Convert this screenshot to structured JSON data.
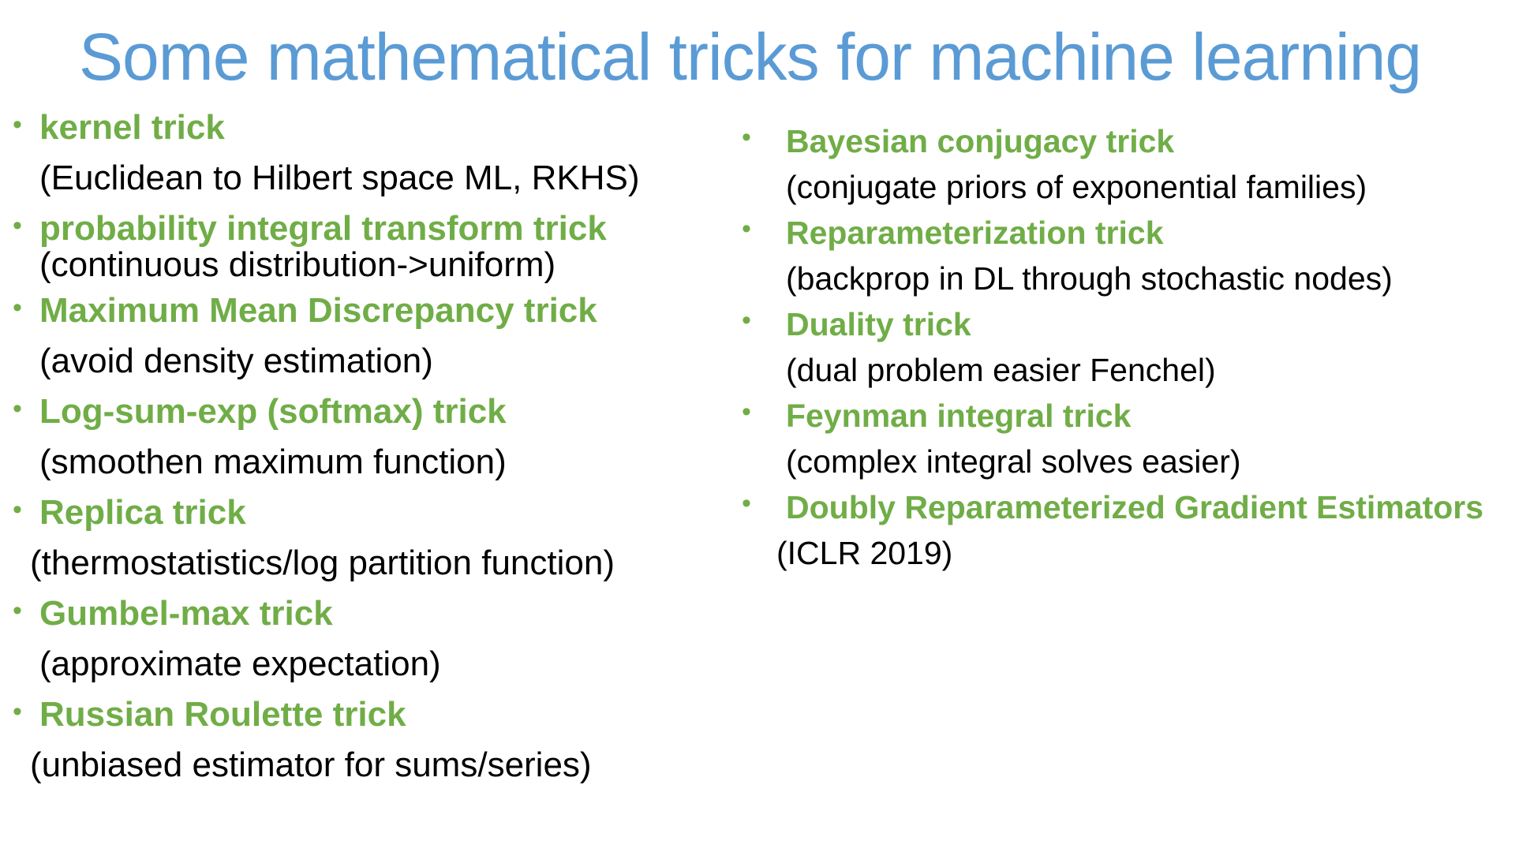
{
  "slide": {
    "title": "Some mathematical tricks for machine learning",
    "colors": {
      "title": "#5b9bd5",
      "heading": "#70ad47",
      "text": "#000000"
    },
    "bullet_glyph": "•",
    "left_items": [
      {
        "heading": "kernel trick",
        "description": "(Euclidean to Hilbert space ML, RKHS)"
      },
      {
        "heading": "probability integral transform trick",
        "description": "(continuous distribution->uniform)"
      },
      {
        "heading": "Maximum Mean Discrepancy trick",
        "description": "(avoid density estimation)"
      },
      {
        "heading": "Log-sum-exp (softmax) trick",
        "description": "(smoothen maximum function)"
      },
      {
        "heading": "Replica trick",
        "description": "(thermostatistics/log partition function)"
      },
      {
        "heading": "Gumbel-max trick",
        "description": "(approximate expectation)"
      },
      {
        "heading": "Russian Roulette trick",
        "description": "(unbiased estimator for sums/series)"
      }
    ],
    "right_items": [
      {
        "heading": "Bayesian conjugacy trick",
        "description": "(conjugate priors of exponential families)"
      },
      {
        "heading": "Reparameterization trick",
        "description": "(backprop in DL through stochastic nodes)"
      },
      {
        "heading": "Duality trick",
        "description": "(dual problem easier Fenchel)"
      },
      {
        "heading": "Feynman integral trick",
        "description": "(complex integral solves easier)"
      },
      {
        "heading": "Doubly Reparameterized Gradient Estimators",
        "description": "(ICLR 2019)"
      }
    ]
  }
}
